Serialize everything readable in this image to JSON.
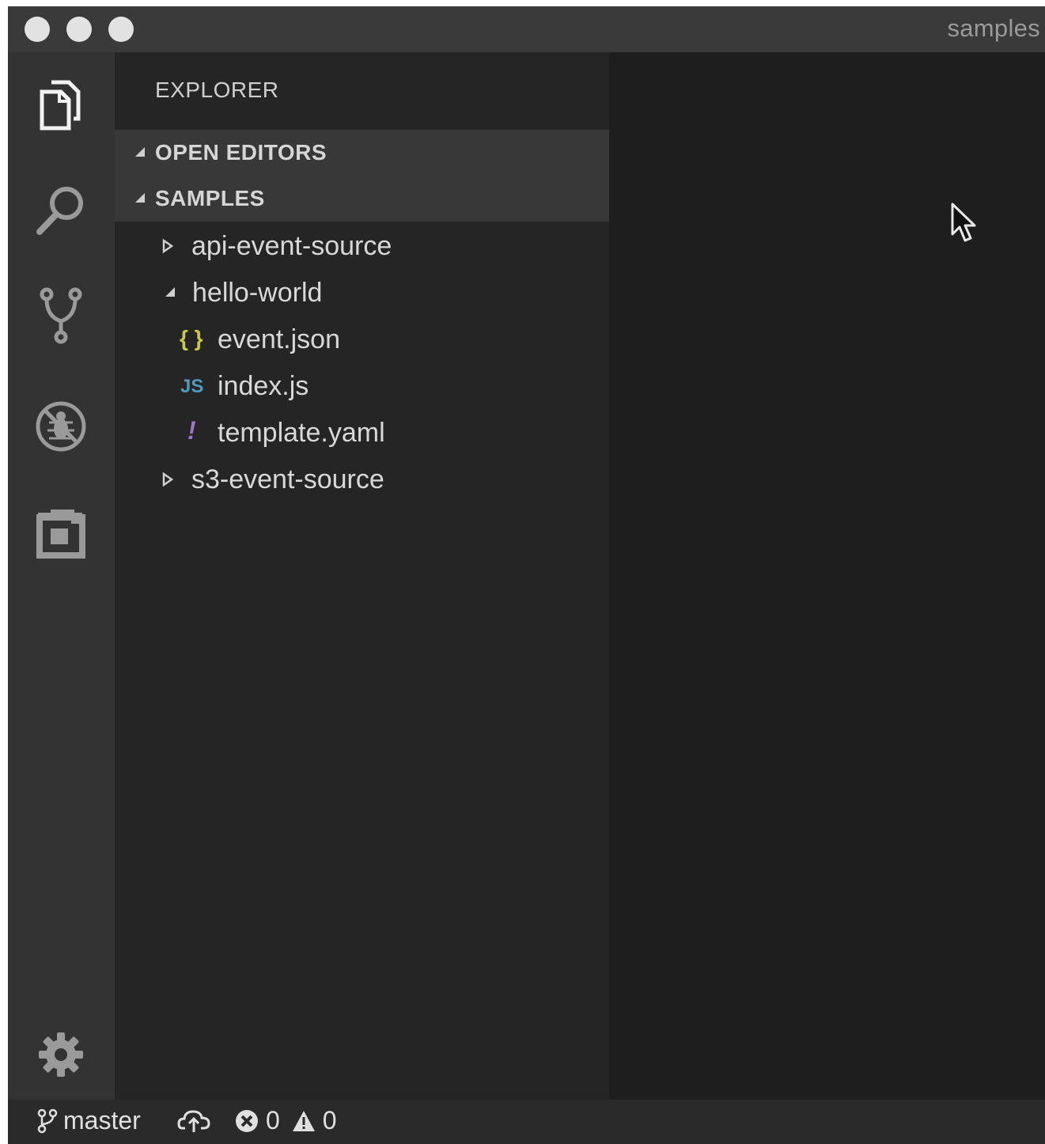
{
  "window": {
    "title": "samples"
  },
  "activity_bar": {
    "icons": [
      "files-icon",
      "search-icon",
      "source-control-icon",
      "debug-icon",
      "extensions-icon",
      "gear-icon"
    ]
  },
  "sidebar": {
    "title": "EXPLORER",
    "sections": [
      {
        "label": "OPEN EDITORS",
        "expanded": true
      },
      {
        "label": "SAMPLES",
        "expanded": true
      }
    ],
    "tree": [
      {
        "label": "api-event-source",
        "type": "folder",
        "expanded": false
      },
      {
        "label": "hello-world",
        "type": "folder",
        "expanded": true
      },
      {
        "label": "event.json",
        "type": "file",
        "icon_text": "{ }",
        "icon_color": "#cbcb41"
      },
      {
        "label": "index.js",
        "type": "file",
        "icon_text": "JS",
        "icon_color": "#519aba"
      },
      {
        "label": "template.yaml",
        "type": "file",
        "icon_text": "!",
        "icon_color": "#a074c4"
      },
      {
        "label": "s3-event-source",
        "type": "folder",
        "expanded": false
      }
    ]
  },
  "status_bar": {
    "branch": "master",
    "errors": "0",
    "warnings": "0"
  }
}
